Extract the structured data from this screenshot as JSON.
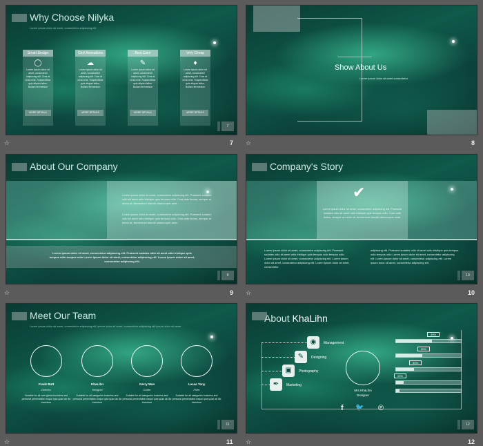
{
  "slides": {
    "s7": {
      "title": "Why Choose Nilyka",
      "subtitle": "Lorem ipsum dolor sit amet, consectetur adipiscing elit.",
      "cards": [
        {
          "head": "Smart Design",
          "icon": "lightbulb-icon",
          "body": "Lorem ipsum dolor sit amet, consectetur adipiscing elit. Cras et urna urna. Suspendisse quis aliquet tellus. Nullam fermentum",
          "button": "MORE DETAILS"
        },
        {
          "head": "Cool Animations",
          "icon": "cloud-icon",
          "body": "Lorem ipsum dolor sit amet, consectetur adipiscing elit. Cras et urna urna. Suspendisse quis aliquet tellus. Nullam fermentum",
          "button": "MORE DETAILS"
        },
        {
          "head": "Best Color",
          "icon": "brush-icon",
          "body": "Lorem ipsum dolor sit amet, consectetur adipiscing elit. Cras et urna urna. Suspendisse quis aliquet tellus. Nullam fermentum",
          "button": "MORE DETAILS"
        },
        {
          "head": "Very Cheap",
          "icon": "ticket-icon",
          "body": "Lorem ipsum dolor sit amet, consectetur adipiscing elit. Cras et urna urna. Suspendisse quis aliquet tellus. Nullam fermentum",
          "button": "MORE DETAILS"
        }
      ],
      "page": "7",
      "footer_num": "7"
    },
    "s8": {
      "title": "Show About Us",
      "subtitle": "Lorem ipsum dolor sit amet consectetur",
      "footer_num": "8"
    },
    "s9": {
      "title": "About Our Company",
      "para1": "Lorem ipsum dolor sit amet, consectetur adipiscing elit. Praesent sodales odio sit amet odio tristique quis tempus odio. Cras ante lectus, semper at lorem at, fermentum blandit ullamcorper ante.",
      "para2": "Lorem ipsum dolor sit amet, consectetur adipiscing elit. Praesent sodales odio sit amet odio tristique quis tempus odio. Cras ante lectus, semper at lorem at, fermentum blandit ullamcorper ante.",
      "bottom": "Lorem ipsum dolor sit amet, consectetur adipiscing elit. Praesent sodales odio sit amet odio tristique quis tempus odio tempus odio Lorem ipsum dolor sit amet, consectetur adipiscing elit. Lorem ipsum dolor sit amet, consectetur adipiscing elit.",
      "page": "9",
      "footer_num": "9"
    },
    "s10": {
      "title": "Company's Story",
      "center": "Lorem ipsum dolor sit amet, consectetur adipiscing elit. Praesent sodales odio sit amet odio tristique quis tempus odio. Cras ante lectus, semper at lorem at, fermentum blandit ullamcorper ante.",
      "left": "Lorem ipsum dolor sit amet, consectetur adipiscing elit. Praesent sodales odio sit amet odio tristique quis tempus odio tempus odio Lorem ipsum dolor sit amet, consectetur adipiscing elit. Lorem ipsum dolor sit amet, consectetur adipiscing elit. Lorem ipsum dolor sit amet, consectetur",
      "right": "adipiscing elit. Praesent sodales odio sit amet odio tristique quis tempus odio tempus odio Lorem ipsum dolor sit amet, consectetur adipiscing elit. Lorem ipsum dolor sit amet, consectetur adipiscing elit. Lorem ipsum dolor sit amet, consectetur adipiscing elit.",
      "page": "10",
      "footer_num": "10"
    },
    "s11": {
      "title": "Meet Our Team",
      "subtitle": "Lorem ipsum dolor sit amet, consectetur adipiscing elit, ipsum dolor sit amet, consectetur adipiscing elit ipsum dolor sit amet.",
      "members": [
        {
          "name": "Frank Butt",
          "role": "Director",
          "desc": "Suitable for all care global business and personal presentation eaque ipsa quae ab illo inventore"
        },
        {
          "name": "KhaLihn",
          "role": "Designer",
          "desc": "Suitable for all categories business and personal presentation eaque ipsa quae ab illo inventore"
        },
        {
          "name": "Gerry Wan",
          "role": "Coder",
          "desc": "Suitable for all categories business and personal presentation eaque ipsa quae ab illo inventore"
        },
        {
          "name": "Lucas Tony",
          "role": "Fixer",
          "desc": "Suitable for all categories business and personal presentation eaque ipsa quae ab illo inventore"
        }
      ],
      "page": "11",
      "footer_num": "11"
    },
    "s12": {
      "title_a": "About",
      "title_b": "KhaLihn",
      "skills": [
        {
          "label": "Management",
          "icon": "map-pin-icon"
        },
        {
          "label": "Designing",
          "icon": "pencil-icon"
        },
        {
          "label": "Photography",
          "icon": "camera-icon"
        },
        {
          "label": "Marketing",
          "icon": "pen-icon"
        }
      ],
      "bars": [
        {
          "pct": "40%",
          "value": 0.4
        },
        {
          "pct": "30%",
          "value": 0.3
        },
        {
          "pct": "30%",
          "value": 0.3
        },
        {
          "pct": "20%",
          "value": 0.2
        },
        {
          "pct": "",
          "value": 0.05
        }
      ],
      "person_name": "Mrs KhaLihn",
      "person_role": "Designer",
      "social": [
        "f",
        "🐦",
        "℗"
      ],
      "page": "12",
      "footer_num": "12"
    }
  },
  "footer_icon": "☆"
}
